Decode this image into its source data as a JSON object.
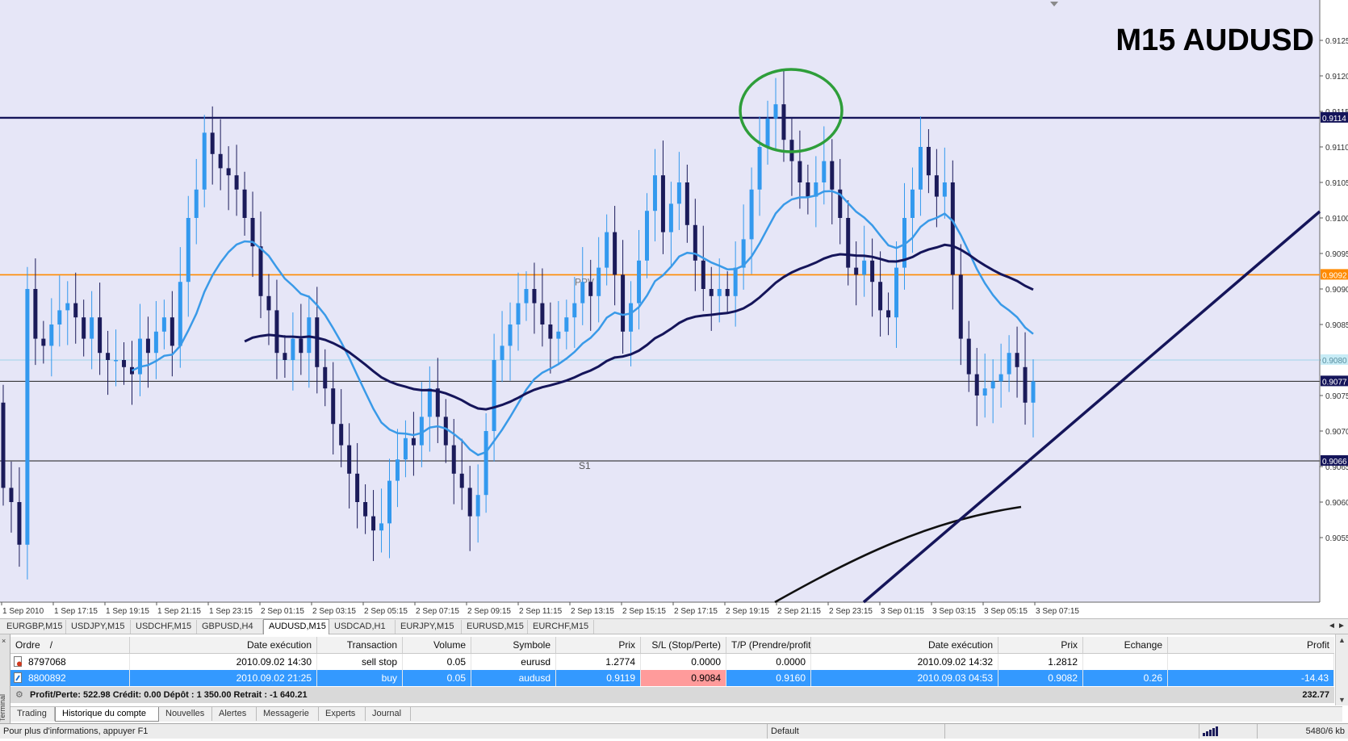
{
  "chart": {
    "title": "M15 AUDUSD",
    "symbol": "AUDUSD",
    "timeframe": "M15",
    "colors": {
      "background": "#e6e6f7",
      "bull": "#3399ee",
      "bear": "#1b1b5a",
      "ema_fast": "#3a9ae8",
      "ema_mid": "#15155a",
      "ema_slow": "#111111",
      "resistance": "#15155a",
      "pivot_line": "#ff8a00",
      "s1_line": "#1b1b1b",
      "price_line": "#222222",
      "annotation_circle": "#2e9e3a",
      "trendline": "#15155a"
    },
    "price_axis_ticks": [
      "0.9125",
      "0.9120",
      "0.9115",
      "0.9110",
      "0.9105",
      "0.9100",
      "0.9095",
      "0.9090",
      "0.9085",
      "0.9080",
      "0.9075",
      "0.9070",
      "0.9065",
      "0.9060",
      "0.9055"
    ],
    "price_markers": [
      {
        "label": "0.9114",
        "value": 0.91141,
        "style": "dark"
      },
      {
        "label": "0.9092",
        "value": 0.9092,
        "style": "orange"
      },
      {
        "label": "0.9080",
        "value": 0.908,
        "style": "light"
      },
      {
        "label": "0.9077",
        "value": 0.9077,
        "style": "dark"
      },
      {
        "label": "0.9066",
        "value": 0.90658,
        "style": "dark"
      }
    ],
    "time_labels": [
      "1 Sep 2010",
      "1 Sep 17:15",
      "1 Sep 19:15",
      "1 Sep 21:15",
      "1 Sep 23:15",
      "2 Sep 01:15",
      "2 Sep 03:15",
      "2 Sep 05:15",
      "2 Sep 07:15",
      "2 Sep 09:15",
      "2 Sep 11:15",
      "2 Sep 13:15",
      "2 Sep 15:15",
      "2 Sep 17:15",
      "2 Sep 19:15",
      "2 Sep 21:15",
      "2 Sep 23:15",
      "3 Sep 01:15",
      "3 Sep 03:15",
      "3 Sep 05:15",
      "3 Sep 07:15"
    ],
    "level_labels": {
      "pivot": "PPV",
      "support": "S1"
    },
    "tabs": [
      "EURGBP,M15",
      "USDJPY,M15",
      "USDCHF,M15",
      "GBPUSD,H4",
      "AUDUSD,M15",
      "USDCAD,H1",
      "EURJPY,M15",
      "EURUSD,M15",
      "EURCHF,M15"
    ],
    "active_tab": "AUDUSD,M15"
  },
  "chart_data": {
    "type": "candlestick",
    "title": "M15 AUDUSD",
    "y_range": [
      0.905,
      0.913
    ],
    "x_labels": [
      "1 Sep 2010",
      "1 Sep 17:15",
      "1 Sep 19:15",
      "1 Sep 21:15",
      "1 Sep 23:15",
      "2 Sep 01:15",
      "2 Sep 03:15",
      "2 Sep 05:15",
      "2 Sep 07:15",
      "2 Sep 09:15",
      "2 Sep 11:15",
      "2 Sep 13:15",
      "2 Sep 15:15",
      "2 Sep 17:15",
      "2 Sep 19:15",
      "2 Sep 21:15",
      "2 Sep 23:15",
      "3 Sep 01:15",
      "3 Sep 03:15",
      "3 Sep 05:15",
      "3 Sep 07:15"
    ],
    "series": [
      {
        "name": "close",
        "description_free": true,
        "values": [
          0.9062,
          0.906,
          0.9054,
          0.909,
          0.9083,
          0.9082,
          0.9085,
          0.9087,
          0.9088,
          0.9086,
          0.9083,
          0.9086,
          0.9081,
          0.908,
          0.908,
          0.9079,
          0.9078,
          0.9083,
          0.9081,
          0.9084,
          0.9086,
          0.9082,
          0.9091,
          0.91,
          0.9104,
          0.9112,
          0.9109,
          0.9107,
          0.9106,
          0.9104,
          0.91,
          0.9096,
          0.9089,
          0.9087,
          0.9081,
          0.908,
          0.9083,
          0.9081,
          0.9086,
          0.9079,
          0.9076,
          0.9071,
          0.9068,
          0.9064,
          0.906,
          0.9058,
          0.9056,
          0.9057,
          0.9063,
          0.9066,
          0.9069,
          0.9068,
          0.9072,
          0.9076,
          0.9072,
          0.9068,
          0.9064,
          0.9062,
          0.9058,
          0.9061,
          0.907,
          0.908,
          0.9082,
          0.9085,
          0.9088,
          0.909,
          0.9088,
          0.9085,
          0.9083,
          0.9084,
          0.9086,
          0.9088,
          0.9091,
          0.9089,
          0.9093,
          0.9098,
          0.9092,
          0.9084,
          0.9088,
          0.9094,
          0.9101,
          0.9106,
          0.9098,
          0.9102,
          0.9105,
          0.9099,
          0.9094,
          0.909,
          0.9089,
          0.909,
          0.9089,
          0.9093,
          0.9097,
          0.9104,
          0.911,
          0.9114,
          0.9116,
          0.9111,
          0.9108,
          0.9105,
          0.9103,
          0.9105,
          0.9108,
          0.9104,
          0.91,
          0.9093,
          0.9092,
          0.9094,
          0.9091,
          0.9087,
          0.9086,
          0.9093,
          0.91,
          0.9104,
          0.911,
          0.9106,
          0.9103,
          0.9105,
          0.9092,
          0.9083,
          0.9078,
          0.9075,
          0.9076,
          0.9077,
          0.9078,
          0.9081,
          0.9079,
          0.9074,
          0.9077
        ]
      }
    ],
    "overlays": [
      "EMA fast",
      "EMA mid",
      "EMA slow",
      "resistance 0.9114",
      "PPV 0.9092",
      "S1 0.9066",
      "trendline"
    ]
  },
  "terminal": {
    "side_label": "Terminal",
    "close_glyph": "×",
    "headers": [
      "Ordre",
      "/",
      "Date exécution",
      "Transaction",
      "Volume",
      "Symbole",
      "Prix",
      "S/L (Stop/Perte)",
      "T/P (Prendre/profit)",
      "Date exécution",
      "Prix",
      "Echange",
      "Profit"
    ],
    "rows": [
      {
        "ordre": "8797068",
        "date1": "2010.09.02 14:30",
        "transaction": "sell stop",
        "volume": "0.05",
        "symbole": "eurusd",
        "prix": "1.2774",
        "sl": "0.0000",
        "tp": "0.0000",
        "date2": "2010.09.02 14:32",
        "prix2": "1.2812",
        "echange": "",
        "profit": ""
      },
      {
        "ordre": "8800892",
        "date1": "2010.09.02 21:25",
        "transaction": "buy",
        "volume": "0.05",
        "symbole": "audusd",
        "prix": "0.9119",
        "sl": "0.9084",
        "tp": "0.9160",
        "date2": "2010.09.03 04:53",
        "prix2": "0.9082",
        "echange": "0.26",
        "profit": "-14.43"
      }
    ],
    "summary": "Profit/Perte: 522.98  Crédit: 0.00  Dépôt : 1 350.00  Retrait : -1 640.21",
    "summary_total": "232.77",
    "tabs": [
      "Trading",
      "Historique du compte",
      "Nouvelles",
      "Alertes",
      "Messagerie",
      "Experts",
      "Journal"
    ],
    "active_tab": "Historique du compte"
  },
  "status": {
    "help": "Pour plus d'informations, appuyer F1",
    "profile": "Default",
    "traffic": "5480/6 kb"
  }
}
